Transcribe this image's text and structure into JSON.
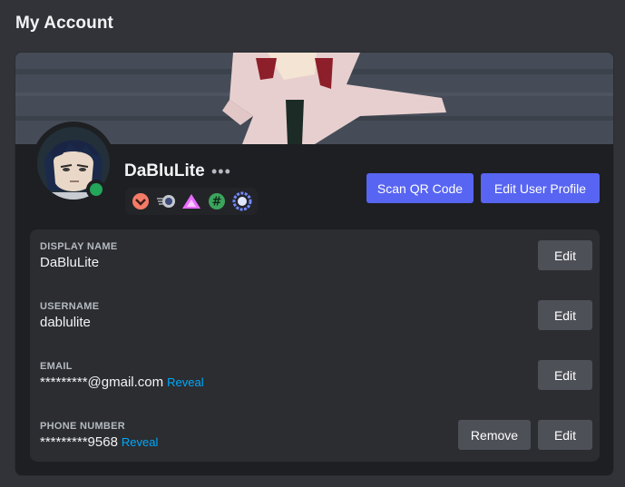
{
  "page": {
    "title": "My Account"
  },
  "profile": {
    "display_name": "DaBluLite",
    "more_label": "•••",
    "status": "online",
    "status_color": "#23a55a",
    "badges": [
      {
        "icon": "chevron-rank-badge-icon",
        "color": "#f47b67"
      },
      {
        "icon": "speed-orb-badge-icon",
        "color": "#c4c9ce"
      },
      {
        "icon": "triangle-badge-icon",
        "color": "#e86bff"
      },
      {
        "icon": "hashtag-badge-icon",
        "color": "#3ba55c"
      },
      {
        "icon": "gear-ring-badge-icon",
        "color": "#7289ff"
      }
    ]
  },
  "actions": {
    "scan_qr_label": "Scan QR Code",
    "edit_profile_label": "Edit User Profile"
  },
  "fields": {
    "display_name": {
      "label": "DISPLAY NAME",
      "value": "DaBluLite",
      "edit_label": "Edit"
    },
    "username": {
      "label": "USERNAME",
      "value": "dablulite",
      "edit_label": "Edit"
    },
    "email": {
      "label": "EMAIL",
      "value": "*********@gmail.com",
      "reveal_label": "Reveal",
      "edit_label": "Edit"
    },
    "phone": {
      "label": "PHONE NUMBER",
      "value": "*********9568",
      "reveal_label": "Reveal",
      "remove_label": "Remove",
      "edit_label": "Edit"
    }
  },
  "colors": {
    "accent": "#5865f2",
    "link": "#00a8fc",
    "secondary_button": "#4e5058"
  }
}
